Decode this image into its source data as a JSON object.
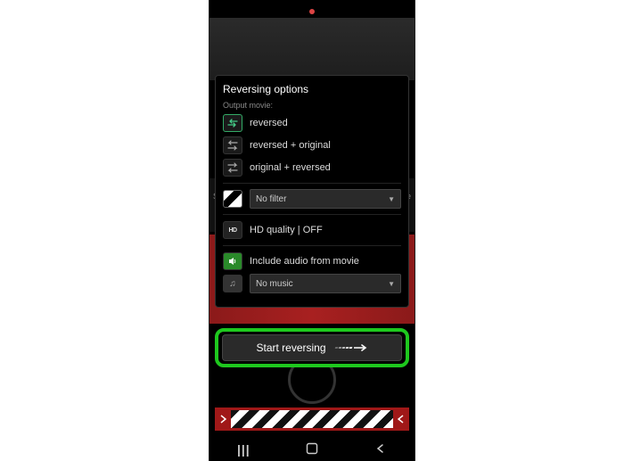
{
  "panel": {
    "title": "Reversing options",
    "subtitle": "Output movie:",
    "options": {
      "reversed": "reversed",
      "reversed_original": "reversed + original",
      "original_reversed": "original + reversed"
    },
    "filter": {
      "selected": "No filter"
    },
    "hd": {
      "label": "HD quality | OFF"
    },
    "audio": {
      "label": "Include audio from movie"
    },
    "music": {
      "selected": "No music"
    }
  },
  "cta": {
    "label": "Start reversing"
  },
  "bg": {
    "left_label": "Se",
    "right_label": "ne"
  },
  "nav": {
    "recents": "|||",
    "home": "○",
    "back": "<"
  }
}
